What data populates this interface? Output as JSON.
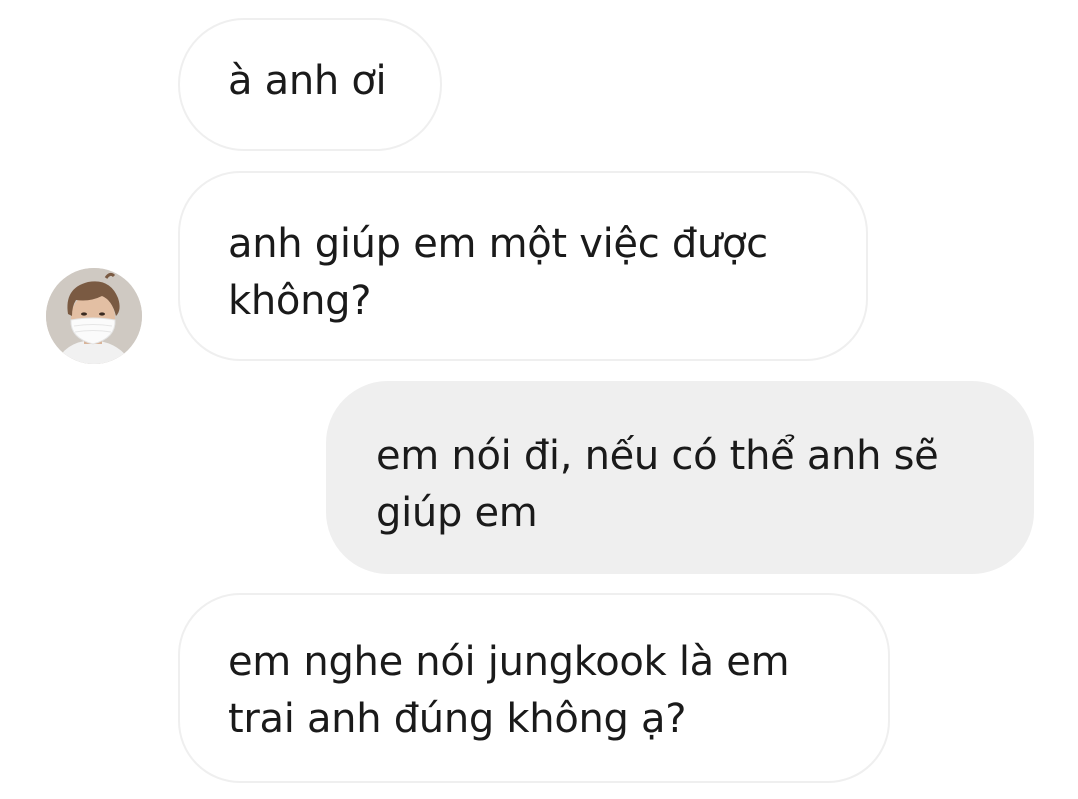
{
  "conversation": {
    "messages": [
      {
        "sender": "other",
        "text": "à anh ơi"
      },
      {
        "sender": "other",
        "text": "anh giúp em một việc được không?"
      },
      {
        "sender": "me",
        "text": "em nói đi, nếu có thể anh sẽ giúp em"
      },
      {
        "sender": "other",
        "text": "em nghe nói jungkook là em trai anh đúng không ạ?"
      }
    ]
  },
  "avatar": {
    "icon": "masked-person-avatar"
  },
  "colors": {
    "background": "#ffffff",
    "incoming_bubble": "#ffffff",
    "incoming_border": "#efefef",
    "outgoing_bubble": "#efefef",
    "text": "#1a1a1a"
  }
}
